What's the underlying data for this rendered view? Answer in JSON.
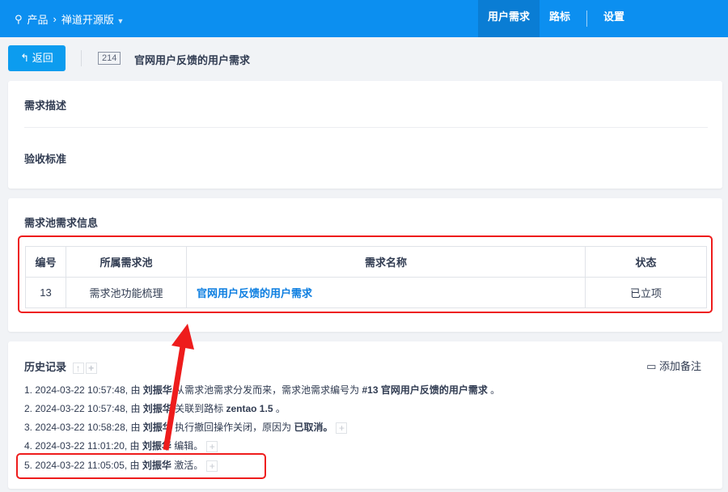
{
  "topbar": {
    "breadcrumb_root": "产品",
    "product": "禅道开源版",
    "nav": [
      "用户需求",
      "路标",
      "设置"
    ]
  },
  "page": {
    "back_label": "返回",
    "id": "214",
    "title": "官网用户反馈的用户需求"
  },
  "sections": {
    "description": "需求描述",
    "acceptance": "验收标准",
    "pool_info": "需求池需求信息"
  },
  "pool_table": {
    "headers": [
      "编号",
      "所属需求池",
      "需求名称",
      "状态"
    ],
    "rows": [
      [
        "13",
        "需求池功能梳理",
        "官网用户反馈的用户需求",
        "已立项"
      ]
    ]
  },
  "history": {
    "title": "历史记录",
    "add_note": "添加备注",
    "entries": [
      {
        "prefix": "1. 2024-03-22 10:57:48, 由 ",
        "user": "刘振华",
        "text": " 从需求池需求分发而来，需求池需求编号为 ",
        "bold": "#13 官网用户反馈的用户需求",
        "suffix": " 。"
      },
      {
        "prefix": "2. 2024-03-22 10:57:48, 由 ",
        "user": "刘振华",
        "text": " 关联到路标 ",
        "bold": "zentao 1.5",
        "suffix": " 。"
      },
      {
        "prefix": "3. 2024-03-22 10:58:28, 由 ",
        "user": "刘振华",
        "text": " 执行撤回操作关闭，原因为 ",
        "bold": "已取消。",
        "suffix": ""
      },
      {
        "prefix": "4. 2024-03-22 11:01:20, 由 ",
        "user": "刘振华",
        "text": " 编辑。",
        "bold": "",
        "suffix": ""
      },
      {
        "prefix": "5. 2024-03-22 11:05:05, 由 ",
        "user": "刘振华",
        "text": " 激活。",
        "bold": "",
        "suffix": ""
      }
    ]
  }
}
